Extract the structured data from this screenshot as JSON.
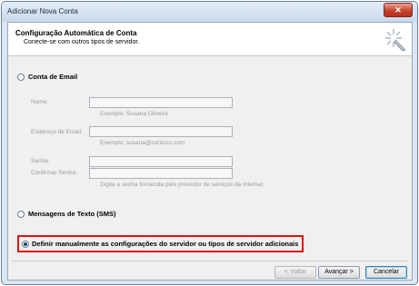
{
  "window": {
    "title": "Adicionar Nova Conta",
    "close_glyph": "✕"
  },
  "header": {
    "title": "Configuração Automática de Conta",
    "subtitle": "Conecte-se com outros tipos de servidor."
  },
  "options": {
    "email": {
      "label": "Conta de Email",
      "selected": false
    },
    "sms": {
      "label": "Mensagens de Texto (SMS)",
      "selected": false
    },
    "manual": {
      "label": "Definir manualmente as configurações do servidor ou tipos de servidor adicionais",
      "selected": true
    }
  },
  "form": {
    "name": {
      "label": "Nome:",
      "value": "",
      "hint": "Exemplo: Susana Oliveira"
    },
    "email": {
      "label": "Endereço de Email:",
      "value": "",
      "hint": "Exemplo: susana@contoso.com"
    },
    "password": {
      "label": "Senha:",
      "value": ""
    },
    "confirm": {
      "label": "Confirmar Senha:",
      "value": "",
      "hint": "Digite a senha fornecida pelo provedor de serviços de Internet."
    }
  },
  "buttons": {
    "back": "< Voltar",
    "next": "Avançar >",
    "cancel": "Cancelar"
  },
  "colors": {
    "highlight": "#e01010",
    "radio_fill": "#1d3f7a"
  },
  "icons": {
    "wizard": "wizard-sparkle-icon",
    "close": "close-icon"
  }
}
